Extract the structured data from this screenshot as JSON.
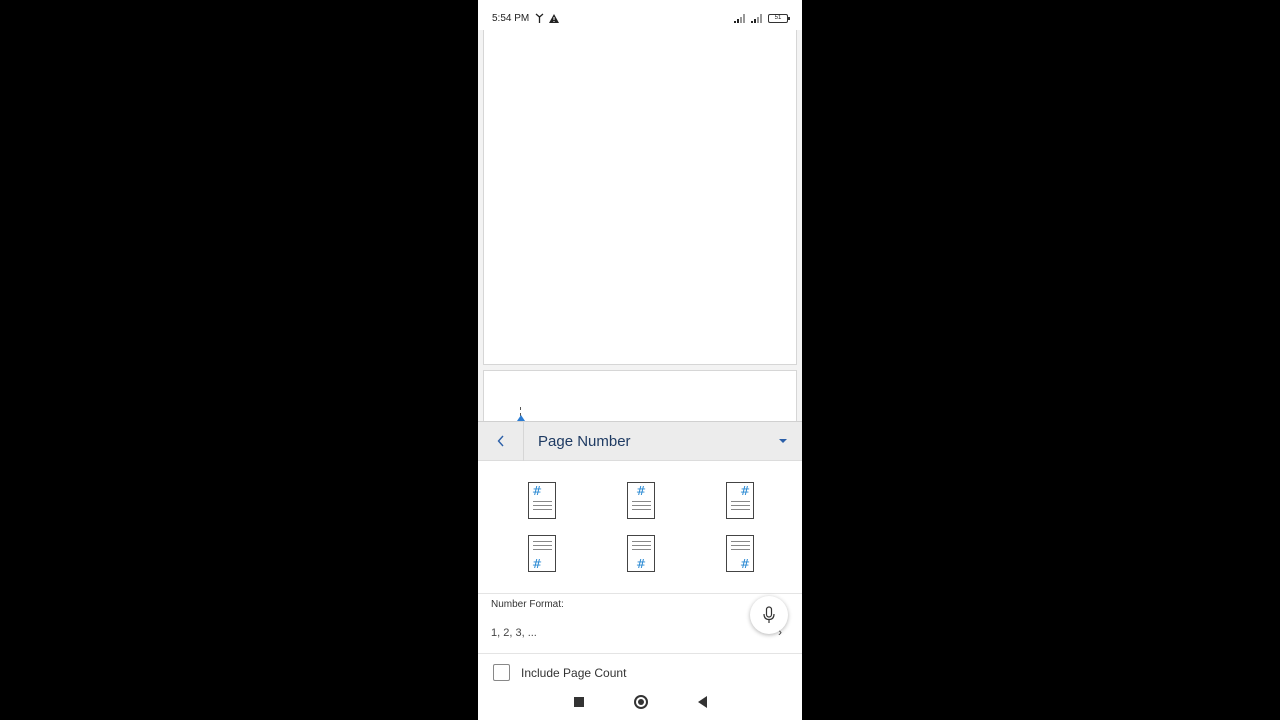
{
  "status_bar": {
    "time": "5:54 PM",
    "battery": "51"
  },
  "panel": {
    "title": "Page Number",
    "back_icon": "chevron-left-icon",
    "dropdown_icon": "caret-down-icon"
  },
  "layouts": {
    "hash_symbol": "#",
    "items": [
      {
        "name": "page-number-top-left",
        "position": "top"
      },
      {
        "name": "page-number-top-center",
        "position": "top"
      },
      {
        "name": "page-number-top-right",
        "position": "top"
      },
      {
        "name": "page-number-bottom-left",
        "position": "bottom"
      },
      {
        "name": "page-number-bottom-center",
        "position": "bottom"
      },
      {
        "name": "page-number-bottom-right",
        "position": "bottom"
      }
    ]
  },
  "number_format": {
    "label": "Number Format:",
    "value": "1, 2, 3, ...",
    "chevron": "›"
  },
  "include_page_count": {
    "label": "Include Page Count",
    "checked": false
  },
  "colors": {
    "accent": "#2b5fa8",
    "hash": "#2b8ad3"
  }
}
